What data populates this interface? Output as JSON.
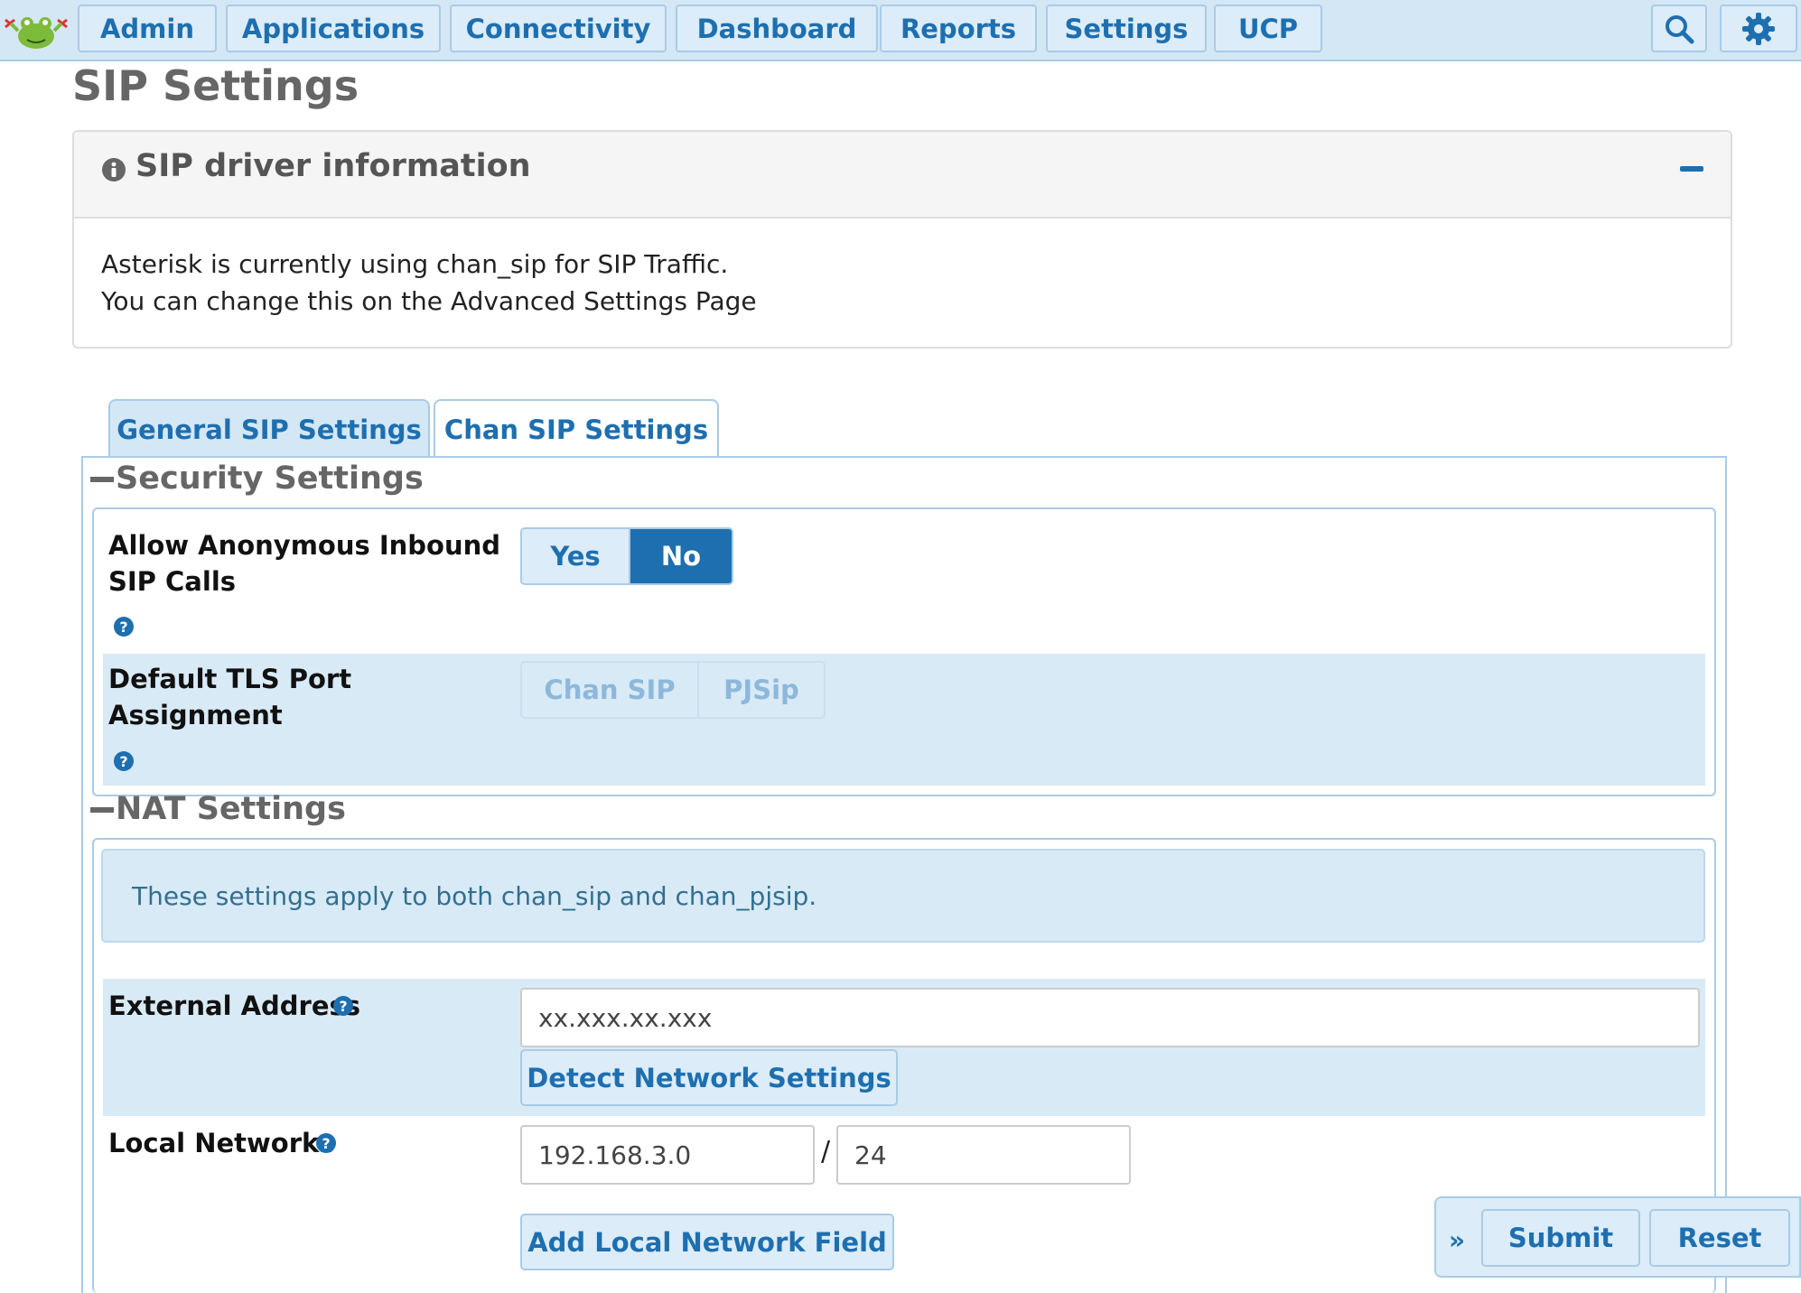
{
  "nav": {
    "items": [
      {
        "label": "Admin"
      },
      {
        "label": "Applications"
      },
      {
        "label": "Connectivity"
      },
      {
        "label": "Dashboard"
      },
      {
        "label": "Reports"
      },
      {
        "label": "Settings"
      },
      {
        "label": "UCP"
      }
    ],
    "search_icon": "search-icon",
    "settings_icon": "gear-icon"
  },
  "page_title": "SIP Settings",
  "info_panel": {
    "title": "SIP driver information",
    "line1": "Asterisk is currently using chan_sip for SIP Traffic.",
    "line2": "You can change this on the Advanced Settings Page"
  },
  "tabs": [
    {
      "label": "General SIP Settings",
      "active": true
    },
    {
      "label": "Chan SIP Settings",
      "active": false
    }
  ],
  "security": {
    "title": "Security Settings",
    "anonymous": {
      "label_line1": "Allow Anonymous Inbound",
      "label_line2": "SIP Calls",
      "options": [
        "Yes",
        "No"
      ],
      "selected": "No"
    },
    "tls": {
      "label_line1": "Default TLS Port",
      "label_line2": "Assignment",
      "options": [
        "Chan SIP",
        "PJSip"
      ],
      "disabled": true
    }
  },
  "nat": {
    "title": "NAT Settings",
    "note": "These settings apply to both chan_sip and chan_pjsip.",
    "external_address": {
      "label": "External Address",
      "value": "xx.xxx.xx.xxx",
      "detect_button": "Detect Network Settings"
    },
    "local_networks": {
      "label": "Local Networks",
      "network": "192.168.3.0",
      "separator": "/",
      "cidr": "24",
      "add_button": "Add Local Network Field"
    }
  },
  "actions": {
    "submit": "Submit",
    "reset": "Reset"
  },
  "colors": {
    "accent": "#1d6fb0",
    "nav_bg": "#d4e7f5",
    "row_shade": "#d9eaf7"
  }
}
